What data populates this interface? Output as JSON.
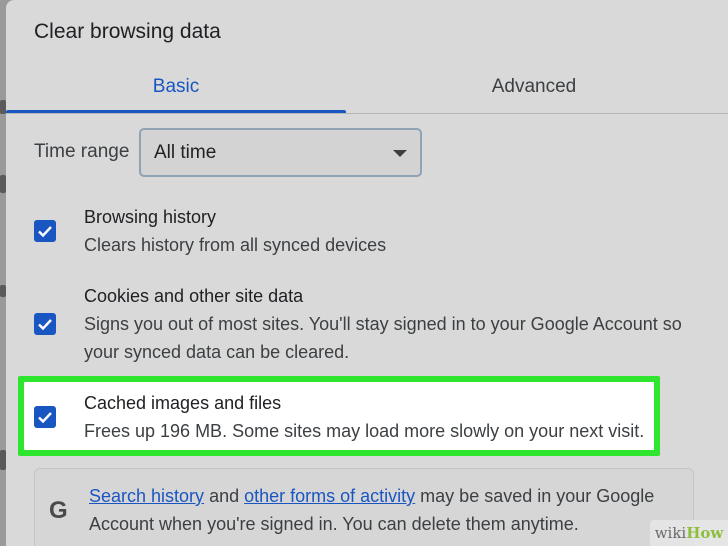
{
  "dialog": {
    "title": "Clear browsing data",
    "tabs": [
      {
        "label": "Basic",
        "active": true
      },
      {
        "label": "Advanced",
        "active": false
      }
    ],
    "time_range": {
      "label": "Time range",
      "value": "All time"
    },
    "options": [
      {
        "title": "Browsing history",
        "description": "Clears history from all synced devices",
        "checked": true
      },
      {
        "title": "Cookies and other site data",
        "description": "Signs you out of most sites. You'll stay signed in to your Google Account so your synced data can be cleared.",
        "checked": true
      },
      {
        "title": "Cached images and files",
        "description": "Frees up 196 MB. Some sites may load more slowly on your next visit.",
        "checked": true,
        "highlighted": true
      }
    ],
    "notice": {
      "link1": "Search history",
      "text1": " and ",
      "link2": "other forms of activity",
      "text2": " may be saved in your Google Account when you're signed in. You can delete them anytime."
    }
  },
  "watermark": {
    "part1": "wiki",
    "part2": "How"
  },
  "colors": {
    "accent": "#1a56c2",
    "highlight_border": "#2ee62e",
    "dialog_bg": "#d9d9d9"
  }
}
